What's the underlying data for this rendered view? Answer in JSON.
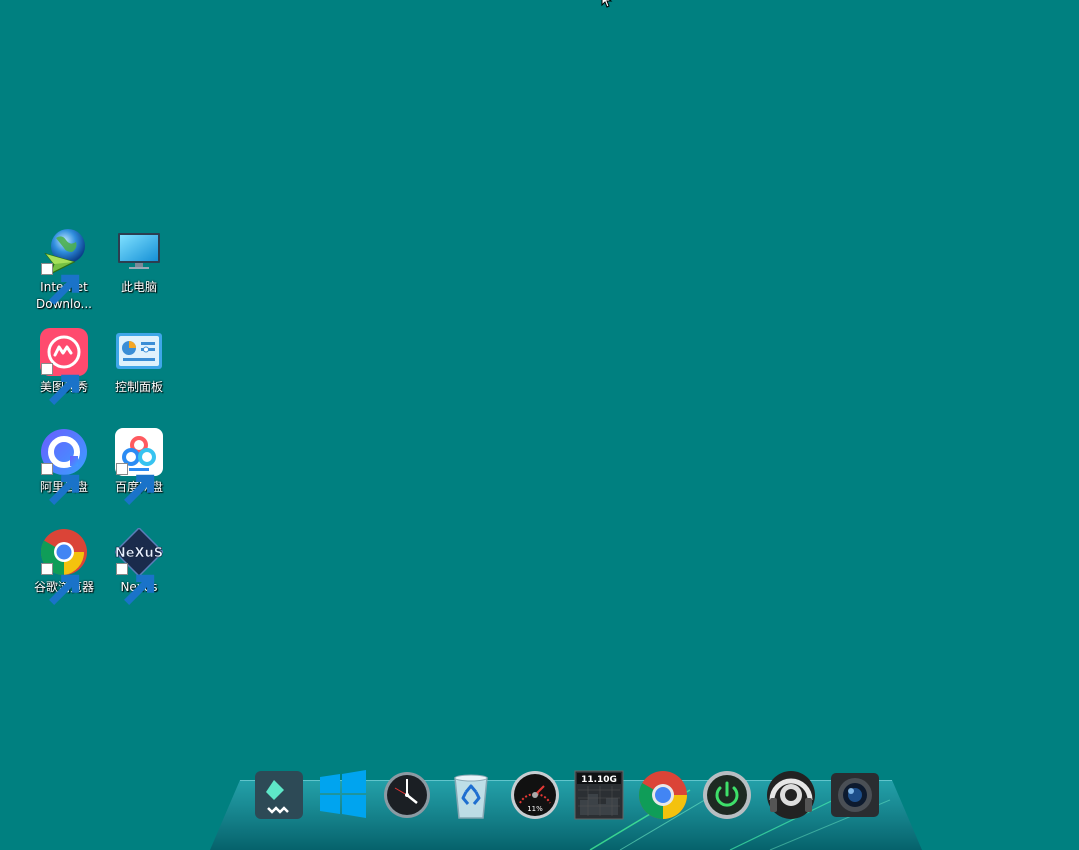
{
  "desktop_icons": [
    {
      "name": "idm",
      "label": "Internet\nDownlo...",
      "icon": "internet-download-manager-icon",
      "shortcut": true
    },
    {
      "name": "this-pc",
      "label": "此电脑",
      "icon": "monitor-icon",
      "shortcut": false
    },
    {
      "name": "meitu",
      "label": "美图秀秀",
      "icon": "meitu-icon",
      "shortcut": true
    },
    {
      "name": "control-panel",
      "label": "控制面板",
      "icon": "control-panel-icon",
      "shortcut": false
    },
    {
      "name": "aliyun-drive",
      "label": "阿里云盘",
      "icon": "aliyun-drive-icon",
      "shortcut": true
    },
    {
      "name": "baidu-netdisk",
      "label": "百度网盘",
      "icon": "baidu-netdisk-icon",
      "shortcut": true
    },
    {
      "name": "chrome",
      "label": "谷歌浏览器",
      "icon": "chrome-icon",
      "shortcut": true
    },
    {
      "name": "nexus",
      "label": "Nexus",
      "icon": "nexus-icon",
      "shortcut": true
    }
  ],
  "dock": {
    "items": [
      {
        "name": "filmora",
        "icon": "filmora-icon"
      },
      {
        "name": "windows-start",
        "icon": "windows-logo-icon"
      },
      {
        "name": "clock",
        "icon": "clock-icon"
      },
      {
        "name": "recycle-bin",
        "icon": "recycle-bin-icon"
      },
      {
        "name": "cpu-meter",
        "icon": "speedometer-icon",
        "value": "11%"
      },
      {
        "name": "ram-meter",
        "icon": "memory-meter-icon",
        "value": "11.10G"
      },
      {
        "name": "chrome",
        "icon": "chrome-icon"
      },
      {
        "name": "power",
        "icon": "power-icon"
      },
      {
        "name": "media-player",
        "icon": "speaker-icon"
      },
      {
        "name": "camera",
        "icon": "camera-icon"
      }
    ]
  },
  "colors": {
    "desktop_bg": "#008080",
    "label_text": "#ffffff"
  }
}
